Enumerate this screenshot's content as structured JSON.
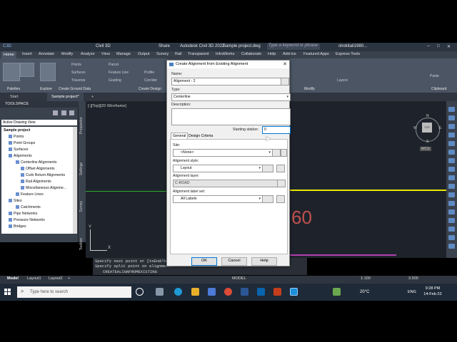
{
  "window": {
    "app_title": "Autodesk Civil 3D 2022",
    "document": "Sample project.dwg",
    "search_placeholder": "Type a keyword or phrase",
    "user": "shokitali1980..."
  },
  "workspace": "Civil 3D",
  "share_label": "Share",
  "ribbon_tabs": [
    "Home",
    "Insert",
    "Annotate",
    "Modify",
    "Analyze",
    "View",
    "Manage",
    "Output",
    "Survey",
    "Rail",
    "Transparent",
    "InfraWorks",
    "Collaborate",
    "Help",
    "Add-ins",
    "Featured Apps",
    "Express Tools"
  ],
  "ribbon": {
    "toolspace_label": "Toolspace",
    "points": "Points",
    "surfaces": "Surfaces",
    "traverse": "Traverse",
    "parcel": "Parcel",
    "feature_line": "Feature Line",
    "grading": "Grading",
    "profile": "Profile",
    "corridor": "Corridor",
    "layers": "Layers",
    "clipboard": "Clipboard",
    "paste": "Paste",
    "panels": [
      "Palettes",
      "Explore",
      "Create Ground Data",
      "Create Design",
      "Modify",
      "Clipboard"
    ]
  },
  "file_tabs": [
    "Start",
    "Sample project*"
  ],
  "toolspace": {
    "title": "TOOLSPACE",
    "view": "Active Drawing View",
    "tree": [
      "Sample project",
      "Points",
      "Point Groups",
      "Surfaces",
      "Alignments",
      "Centerline Alignments",
      "Offset Alignments",
      "Curb Return Alignments",
      "Rail Alignments",
      "Miscellaneous Alignme...",
      "Feature Lines",
      "Sites",
      "Catchments",
      "Pipe Networks",
      "Pressure Networks",
      "Bridges"
    ],
    "side_tabs": [
      "Prospector",
      "Settings",
      "Survey",
      "Toolbox"
    ]
  },
  "viewport": {
    "label": "[-][Top][2D Wireframe]",
    "text_60": "60",
    "compass": {
      "n": "N",
      "s": "S",
      "e": "E",
      "w": "W",
      "top": "TOP"
    },
    "wcs": "WCS",
    "axis_x": "X",
    "axis_y": "Y"
  },
  "command": {
    "line1": "Specify next point or [toEnd/to...",
    "line2": "Specify split point on alignme...",
    "current": "CREATEALIGNFROMEXISTING"
  },
  "status": {
    "tabs": [
      "Model",
      "Layout1",
      "Layout2"
    ],
    "model": "MODEL",
    "scale": "1:100",
    "elevation": "3.500"
  },
  "dialog": {
    "title": "Create Alignment from Existing Alignment",
    "name_label": "Name:",
    "name_value": "Alignment - 2",
    "type_label": "Type:",
    "type_value": "Centerline",
    "description_label": "Description:",
    "starting_station_label": "Starting station:",
    "starting_station_value": "0",
    "tabs": [
      "General",
      "Design Criteria"
    ],
    "site_label": "Site:",
    "site_value": "<None>",
    "style_label": "Alignment style:",
    "style_value": "Layout",
    "layer_label": "Alignment layer:",
    "layer_value": "C-ROAD",
    "label_set_label": "Alignment label set:",
    "label_set_value": "All Labels",
    "ok": "OK",
    "cancel": "Cancel",
    "help": "Help"
  },
  "taskbar": {
    "search": "Type here to search",
    "temp": "20°C",
    "lang": "ENG",
    "time": "9:28 PM",
    "date": "14-Feb-22"
  },
  "colors": {
    "yellow_line": "#e8e800",
    "green_line": "#2da82d",
    "text_60": "#c0504d"
  }
}
